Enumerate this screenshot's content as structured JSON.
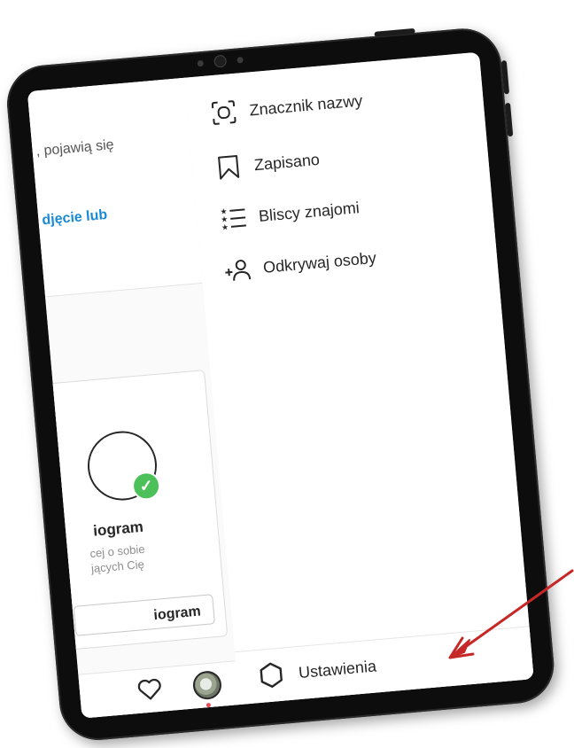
{
  "left_page": {
    "hint_text": ", pojawią się",
    "link_text": "djęcie lub",
    "card": {
      "title": "iogram",
      "desc_line1": "cej o sobie",
      "desc_line2": "jących Cię",
      "button_label": "iogram"
    }
  },
  "menu": {
    "items": [
      {
        "icon": "nametag-icon",
        "label": "Znacznik nazwy"
      },
      {
        "icon": "bookmark-icon",
        "label": "Zapisano"
      },
      {
        "icon": "close-friends-list-icon",
        "label": "Bliscy znajomi"
      },
      {
        "icon": "add-person-icon",
        "label": "Odkrywaj osoby"
      }
    ],
    "settings_label": "Ustawienia"
  },
  "colors": {
    "link": "#1a8ad4",
    "check": "#4cc15a",
    "arrow": "#c62828",
    "notification_dot": "#ed4956"
  }
}
